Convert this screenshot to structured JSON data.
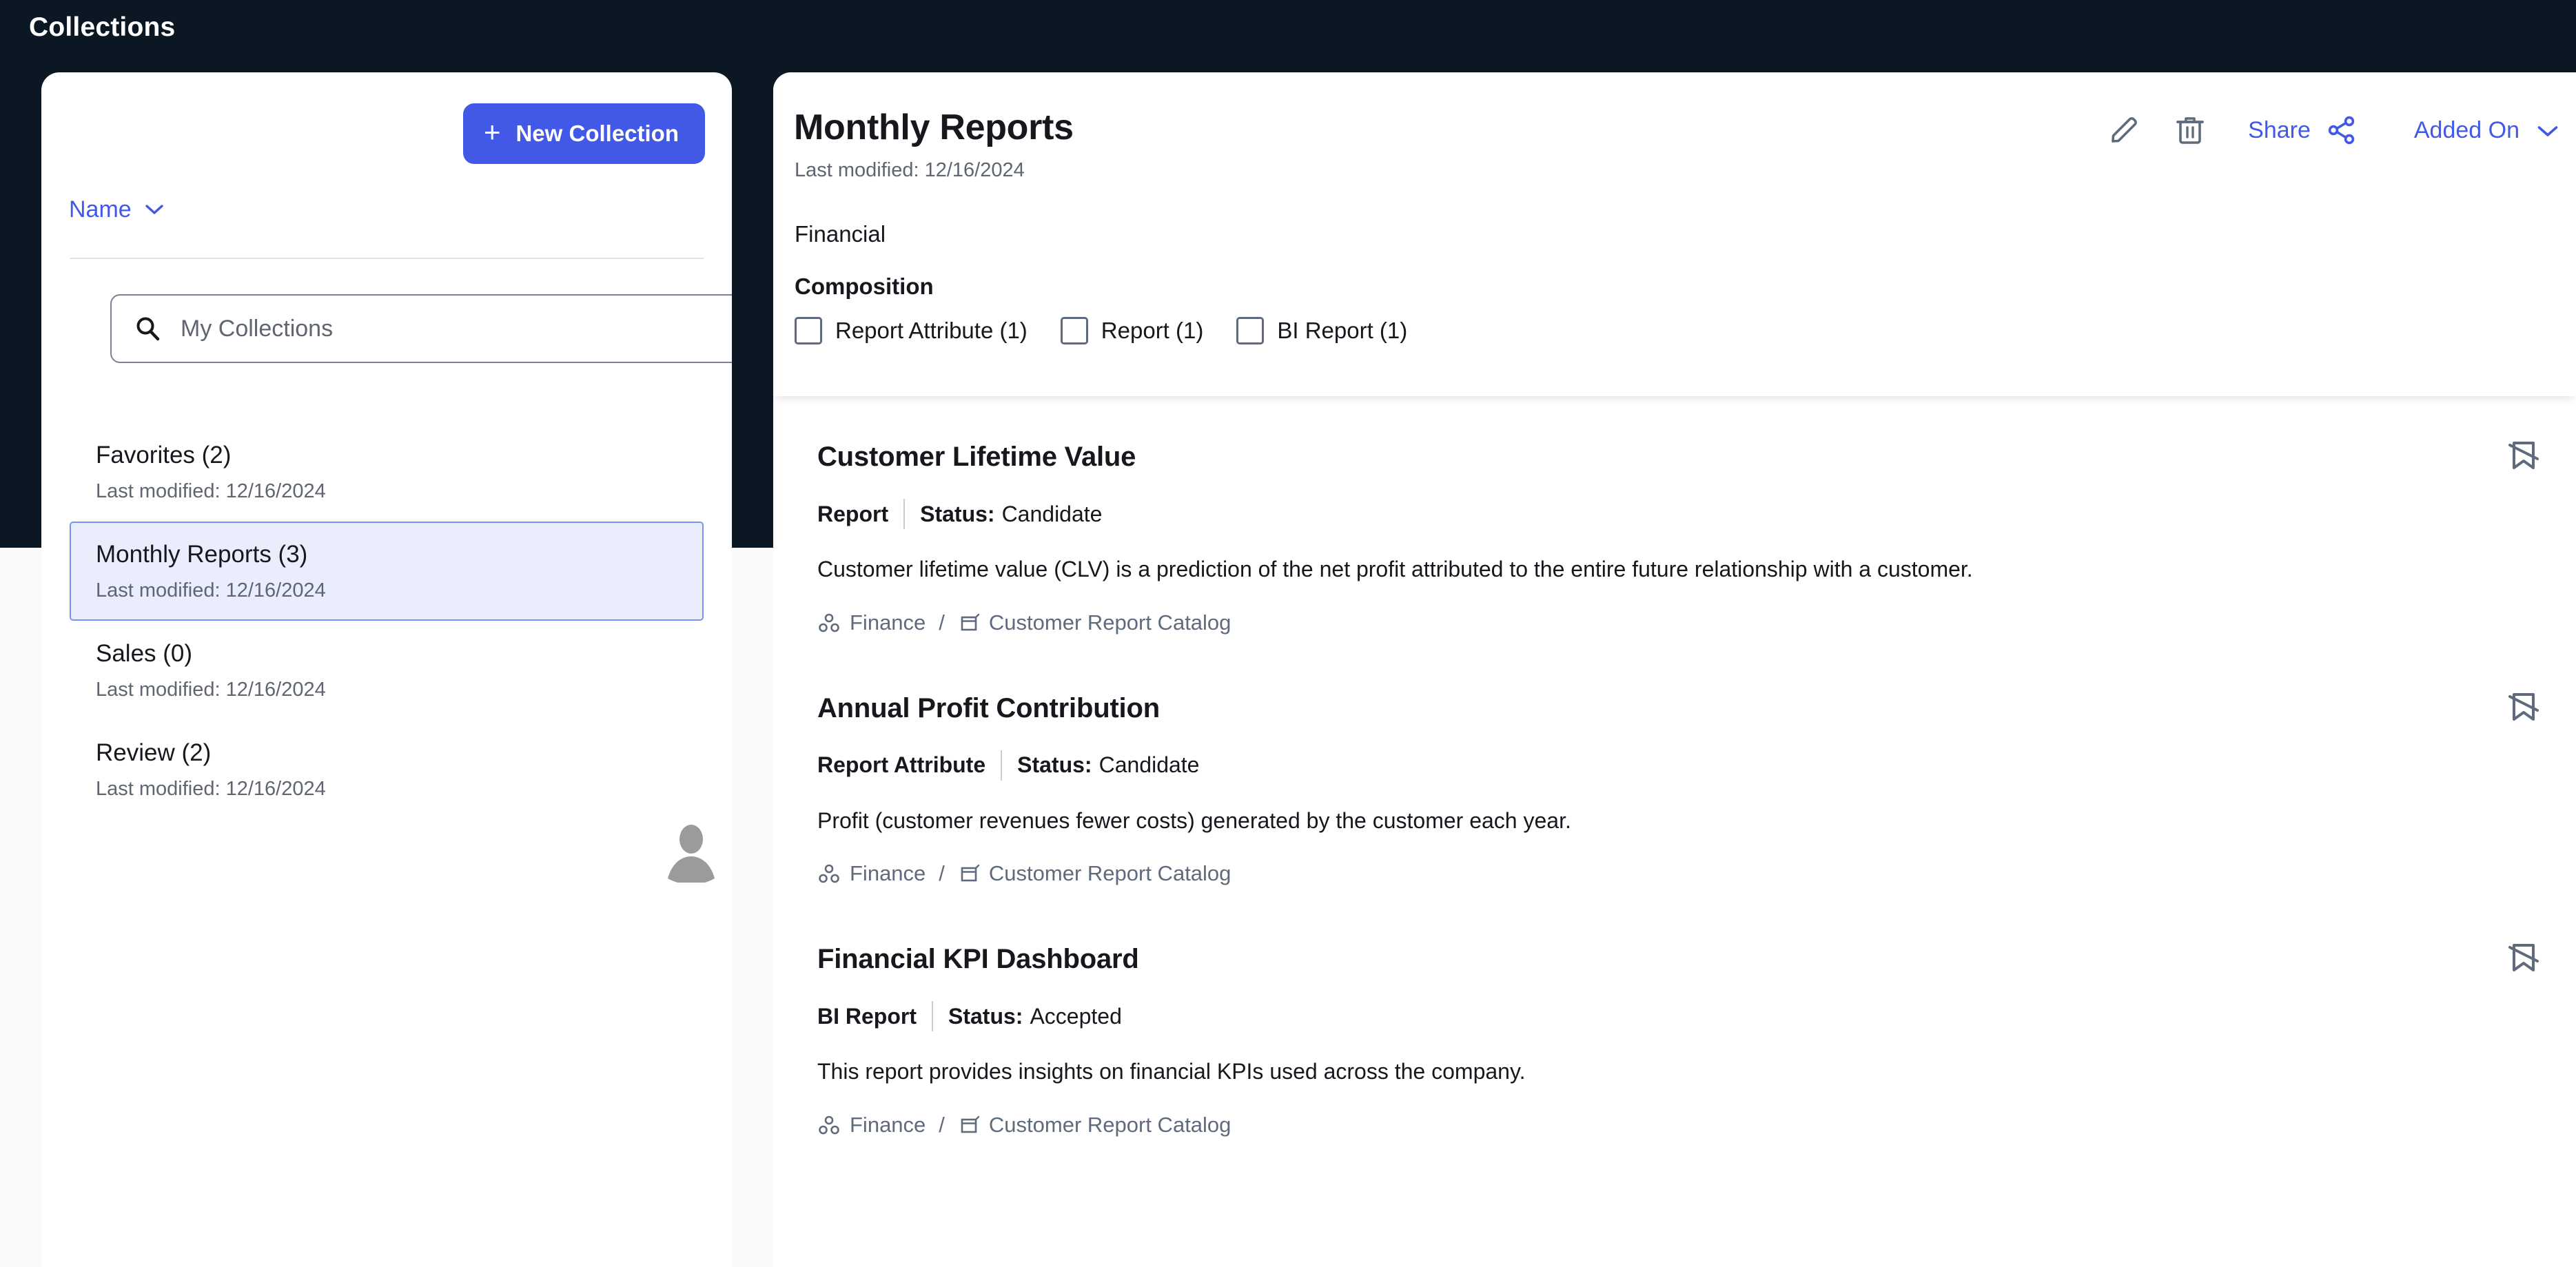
{
  "app": {
    "page_title": "Collections",
    "background_color": "#0c1724",
    "accent_color": "#4259e8"
  },
  "sidebar": {
    "new_collection_label": "New Collection",
    "new_collection_icon": "plus-icon",
    "sort": {
      "label": "Name",
      "icon": "chevron-down-icon"
    },
    "search": {
      "placeholder": "My Collections",
      "value": "",
      "icon": "search-icon"
    },
    "avatar_icon": "user-avatar-icon",
    "items": [
      {
        "name": "Favorites (2)",
        "modified": "Last modified: 12/16/2024",
        "selected": false
      },
      {
        "name": "Monthly Reports (3)",
        "modified": "Last modified: 12/16/2024",
        "selected": true
      },
      {
        "name": "Sales (0)",
        "modified": "Last modified: 12/16/2024",
        "selected": false
      },
      {
        "name": "Review (2)",
        "modified": "Last modified: 12/16/2024",
        "selected": false
      }
    ]
  },
  "detail": {
    "title": "Monthly Reports",
    "modified": "Last modified: 12/16/2024",
    "description": "Financial",
    "composition_label": "Composition",
    "composition": [
      {
        "label": "Report Attribute (1)",
        "checked": false
      },
      {
        "label": "Report (1)",
        "checked": false
      },
      {
        "label": "BI Report (1)",
        "checked": false
      }
    ],
    "actions": {
      "edit_icon": "pencil-icon",
      "delete_icon": "trash-icon",
      "share_label": "Share",
      "share_icon": "share-icon",
      "sort_label": "Added On",
      "sort_icon": "chevron-down-icon"
    }
  },
  "results": [
    {
      "title": "Customer Lifetime Value",
      "type": "Report",
      "status_label": "Status:",
      "status_value": "Candidate",
      "description": "Customer lifetime value (CLV) is a prediction of the net profit attributed to the entire future relationship with a customer.",
      "path_project": "Finance",
      "path_separator": "/",
      "path_folder": "Customer Report Catalog",
      "project_icon": "hierarchy-icon",
      "folder_icon": "cube-icon",
      "bookmark_icon": "bookmark-remove-icon"
    },
    {
      "title": "Annual Profit Contribution",
      "type": "Report Attribute",
      "status_label": "Status:",
      "status_value": "Candidate",
      "description": "Profit (customer revenues fewer costs) generated by the customer each year.",
      "path_project": "Finance",
      "path_separator": "/",
      "path_folder": "Customer Report Catalog",
      "project_icon": "hierarchy-icon",
      "folder_icon": "cube-icon",
      "bookmark_icon": "bookmark-remove-icon"
    },
    {
      "title": "Financial KPI Dashboard",
      "type": "BI Report",
      "status_label": "Status:",
      "status_value": "Accepted",
      "description": "This report provides insights on financial KPIs used across the company.",
      "path_project": "Finance",
      "path_separator": "/",
      "path_folder": "Customer Report Catalog",
      "project_icon": "hierarchy-icon",
      "folder_icon": "cube-icon",
      "bookmark_icon": "bookmark-remove-icon"
    }
  ]
}
